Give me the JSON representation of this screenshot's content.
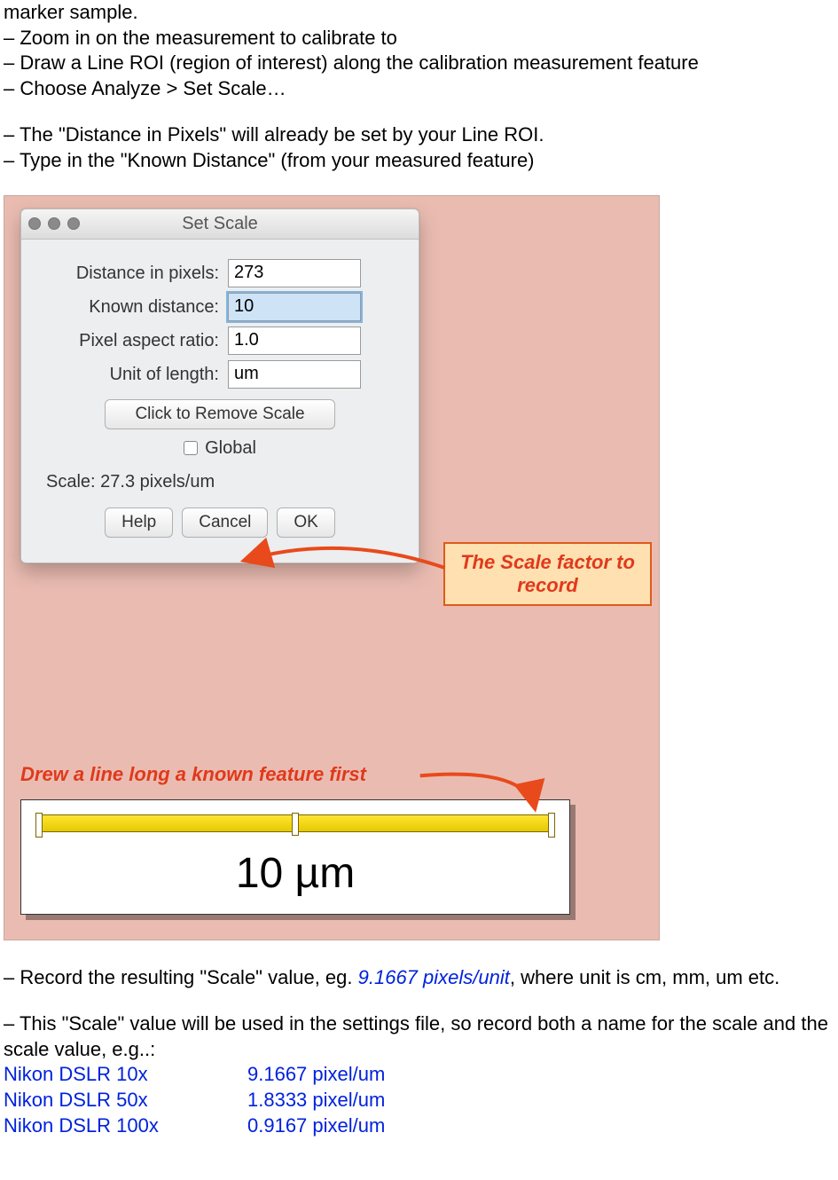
{
  "intro": {
    "l0": "marker sample.",
    "l1": "– Zoom in on the measurement to calibrate to",
    "l2": "– Draw a Line ROI (region of interest) along the calibration measurement feature",
    "l3": "– Choose Analyze > Set Scale…",
    "l4": "– The \"Distance in Pixels\" will already be set by your Line ROI.",
    "l5": "– Type in the \"Known Distance\" (from your measured feature)"
  },
  "dialog": {
    "title": "Set Scale",
    "rows": {
      "distance_label": "Distance in pixels:",
      "distance_value": "273",
      "known_label": "Known distance:",
      "known_value": "10",
      "aspect_label": "Pixel aspect ratio:",
      "aspect_value": "1.0",
      "unit_label": "Unit of length:",
      "unit_value": "um"
    },
    "remove_btn": "Click to Remove Scale",
    "global_label": "Global",
    "scale_text": "Scale: 27.3 pixels/um",
    "buttons": {
      "help": "Help",
      "cancel": "Cancel",
      "ok": "OK"
    }
  },
  "callouts": {
    "scale_factor": "The Scale factor to record",
    "drew_line": "Drew a line long a known feature first"
  },
  "scalebar_label": "10 µm",
  "after": {
    "p1a": "– Record the resulting \"Scale\" value, eg. ",
    "p1b": "9.1667 pixels/unit",
    "p1c": ", where unit is cm, mm, um etc.",
    "p2": "– This \"Scale\" value will be used in the settings file, so record both a name for the scale and the scale value, e.g..:"
  },
  "scale_examples": [
    {
      "name": "Nikon DSLR 10x",
      "value": "9.1667 pixel/um"
    },
    {
      "name": "Nikon DSLR 50x",
      "value": "1.8333 pixel/um"
    },
    {
      "name": "Nikon DSLR 100x",
      "value": "0.9167 pixel/um"
    }
  ]
}
